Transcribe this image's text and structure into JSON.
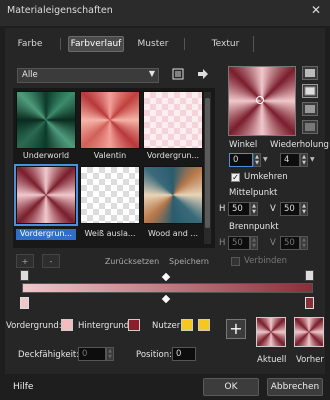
{
  "window": {
    "title": "Materialeigenschaften",
    "close_glyph": "✕"
  },
  "tabs": [
    {
      "label": "Farbe",
      "active": false
    },
    {
      "label": "Farbverlauf",
      "active": true
    },
    {
      "label": "Muster",
      "active": false
    },
    {
      "label": "Textur",
      "active": false
    }
  ],
  "library": {
    "dropdown_value": "Alle",
    "icons": [
      "library-icon",
      "arrow-right-icon"
    ]
  },
  "thumbnails": [
    {
      "label": "Underworld",
      "selected": false
    },
    {
      "label": "Valentin",
      "selected": false
    },
    {
      "label": "Vordergrun...",
      "selected": false
    },
    {
      "label": "Vordergrun...",
      "selected": true
    },
    {
      "label": "Weiß ausla...",
      "selected": false
    },
    {
      "label": "Wood and ...",
      "selected": false
    }
  ],
  "list_buttons": {
    "add": "+",
    "remove": "-",
    "reset": "Zurücksetzen",
    "save": "Speichern"
  },
  "angle": {
    "label": "Winkel",
    "value": "0"
  },
  "repeat": {
    "label": "Wiederholung",
    "value": "4"
  },
  "invert": {
    "label": "Umkehren",
    "checked": true
  },
  "center": {
    "label": "Mittelpunkt",
    "h_label": "H",
    "h_value": "50",
    "v_label": "V",
    "v_value": "50"
  },
  "focal": {
    "label": "Brennpunkt",
    "h_label": "H",
    "h_value": "50",
    "v_label": "V",
    "v_value": "50",
    "link_label": "Verbinden"
  },
  "gradient_bar": {
    "colors": [
      "#f0c8cc",
      "#8b2e38"
    ]
  },
  "colors": {
    "foreground_label": "Vordergrund:",
    "background_label": "Hintergrund:",
    "user_label": "Nutzer:",
    "foreground": "#f3bcc1",
    "background": "#8b1e28",
    "user1": "#f4c81c",
    "user2": "#f4c81c"
  },
  "opacity": {
    "label": "Deckfähigkeit:",
    "value": "0"
  },
  "position": {
    "label": "Position:",
    "value": "0"
  },
  "swatches": {
    "current_label": "Aktuell",
    "previous_label": "Vorher"
  },
  "footer": {
    "help": "Hilfe",
    "ok": "OK",
    "cancel": "Abbrechen"
  }
}
